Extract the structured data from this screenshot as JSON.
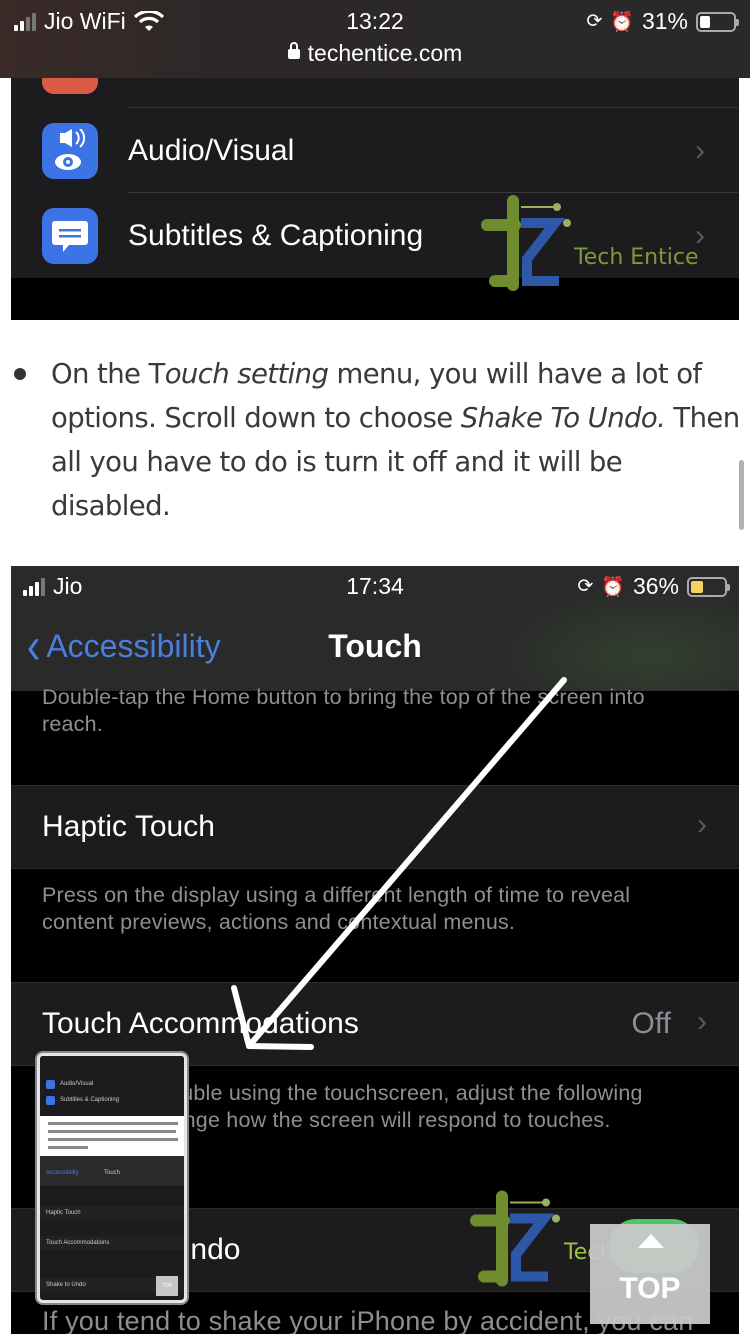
{
  "outer_status": {
    "carrier": "Jio WiFi",
    "time": "13:22",
    "battery": "31%",
    "battery_fraction": 0.31,
    "url": "techentice.com"
  },
  "screenshot1": {
    "rows": [
      {
        "label": "Audio/Visual",
        "icon": "audio-visual-icon"
      },
      {
        "label": "Subtitles & Captioning",
        "icon": "subtitles-icon"
      }
    ],
    "watermark": "Tech Entice"
  },
  "article": {
    "p_1": "On the T",
    "p_2": "ouch setting",
    "p_3": " menu, you will have a lot of options. Scroll down to choose ",
    "p_4": "Shake To Undo.",
    "p_5": " Then all you have to do is turn it off and it will be disabled."
  },
  "screenshot2": {
    "status": {
      "carrier": "Jio",
      "time": "17:34",
      "battery": "36%",
      "battery_fraction": 0.36
    },
    "nav": {
      "back_label": "Accessibility",
      "title": "Touch"
    },
    "reachability_desc": "Double-tap the Home button to bring the top of the screen into reach.",
    "haptic_touch": {
      "label": "Haptic Touch"
    },
    "haptic_desc": "Press on the display using a different length of time to reveal content previews, actions and contextual menus.",
    "touch_accommodations": {
      "label": "Touch Accommodations",
      "value": "Off"
    },
    "accommodations_desc": "If you have trouble using the touchscreen, adjust the following settings to change how the screen will respond to touches.",
    "shake_to_undo": {
      "label": "Shake to Undo",
      "toggle_on": true
    },
    "shake_desc": "If you tend to shake your iPhone by accident, you can",
    "watermark": "Tech Entice"
  },
  "thumbnail": {
    "rows": [
      "Audio/Visual",
      "Subtitles & Captioning",
      "Accessibility",
      "Touch",
      "Haptic Touch",
      "Touch Accommodations",
      "Shake to Undo"
    ],
    "top": "TOP"
  },
  "top_button": {
    "label": "TOP"
  }
}
